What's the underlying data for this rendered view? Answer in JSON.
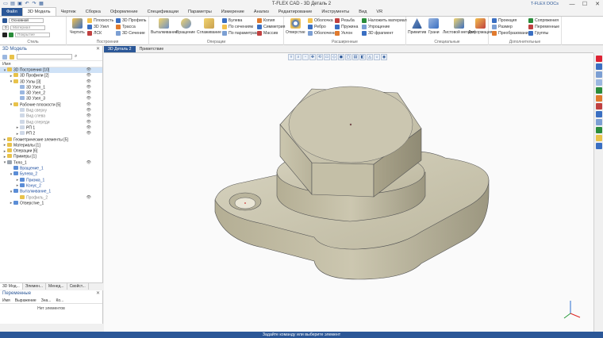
{
  "app": {
    "title": "T-FLEX CAD - 3D Деталь 2",
    "user_label": "T-FLEX DOCs",
    "min": "—",
    "max": "☐",
    "close": "✕"
  },
  "tabs": [
    "Файл",
    "3D Модель",
    "Чертеж",
    "Сборка",
    "Оформление",
    "Спецификации",
    "Параметры",
    "Измерение",
    "Анализ",
    "Редактирование",
    "Инструменты",
    "Вид",
    "VR"
  ],
  "ribbon": {
    "style": {
      "label": "Стиль",
      "style_value": "Основной",
      "material_placeholder": "Материал",
      "coating_placeholder": "Покрытие",
      "thickness_value": "0"
    },
    "construct": {
      "label": "Построения",
      "draw": "Чертить",
      "plane": "Плоскость",
      "node3d": "3D Узел",
      "lsk": "ЛСК",
      "profile3d": "3D Профиль",
      "trace": "Трасса",
      "section3d": "3D Сечение"
    },
    "ops": {
      "label": "Операции",
      "extrude": "Выталкивание",
      "rotate": "Вращение",
      "smooth": "Сглаживание",
      "boolean": "Булева",
      "by_section": "По сечениям",
      "by_params": "По параметрам",
      "copy": "Копия",
      "symmetry": "Симметрия",
      "array": "Массив"
    },
    "ext": {
      "label": "Расширенные",
      "hole": "Отверстие",
      "shell": "Оболочка",
      "rib": "Ребро",
      "offset": "Оболочение",
      "thread": "Резьба",
      "spring": "Пружина",
      "slope": "Уклон",
      "apply_material": "Наложить материал",
      "simplify": "Упрощение",
      "fragment3d": "3D фрагмент"
    },
    "special": {
      "label": "Специальные",
      "primitives": "Примитив",
      "faces": "Грани",
      "sheet_metal": "Листовой металл",
      "deform": "Деформация"
    },
    "extra": {
      "label": "Дополнительные",
      "projection": "Проекция",
      "size": "Размер",
      "transform": "Преобразования",
      "mates": "Сопряжения",
      "variables": "Переменные",
      "groups": "Группы"
    }
  },
  "left_panel": {
    "title": "3D Модель",
    "col_name": "Имя",
    "tree": [
      {
        "label": "3D Построения [10]",
        "indent": 0,
        "toggle": "▾",
        "color": "#e8c24a",
        "cls": "sel",
        "eye": "👁"
      },
      {
        "label": "3D Профили [2]",
        "indent": 1,
        "toggle": "▸",
        "color": "#e8c24a",
        "cls": "",
        "eye": "👁"
      },
      {
        "label": "3D Узлы [3]",
        "indent": 1,
        "toggle": "▾",
        "color": "#e8c24a",
        "cls": "",
        "eye": "👁"
      },
      {
        "label": "3D Узел_1",
        "indent": 2,
        "toggle": "",
        "color": "#9bb7e0",
        "cls": "",
        "eye": "👁"
      },
      {
        "label": "3D Узел_2",
        "indent": 2,
        "toggle": "",
        "color": "#9bb7e0",
        "cls": "",
        "eye": "👁"
      },
      {
        "label": "3D Узел_3",
        "indent": 2,
        "toggle": "",
        "color": "#9bb7e0",
        "cls": "",
        "eye": "👁"
      },
      {
        "label": "Рабочие плоскости [5]",
        "indent": 1,
        "toggle": "▾",
        "color": "#e8c24a",
        "cls": "",
        "eye": "👁"
      },
      {
        "label": "Вид сверху",
        "indent": 2,
        "toggle": "",
        "color": "#cfd8e6",
        "cls": "gray",
        "eye": "👁"
      },
      {
        "label": "Вид слева",
        "indent": 2,
        "toggle": "",
        "color": "#cfd8e6",
        "cls": "gray",
        "eye": "👁"
      },
      {
        "label": "Вид спереди",
        "indent": 2,
        "toggle": "",
        "color": "#cfd8e6",
        "cls": "gray",
        "eye": "👁"
      },
      {
        "label": "РП 1",
        "indent": 2,
        "toggle": "▸",
        "color": "#cfd8e6",
        "cls": "",
        "eye": "👁"
      },
      {
        "label": "РП 2",
        "indent": 2,
        "toggle": "▸",
        "color": "#cfd8e6",
        "cls": "",
        "eye": "👁"
      },
      {
        "label": "Геометрические элементы [5]",
        "indent": 0,
        "toggle": "▸",
        "color": "#e8c24a",
        "cls": "",
        "eye": ""
      },
      {
        "label": "Материалы [1]",
        "indent": 0,
        "toggle": "▸",
        "color": "#e8c24a",
        "cls": "",
        "eye": ""
      },
      {
        "label": "Операции [6]",
        "indent": 0,
        "toggle": "▸",
        "color": "#e8c24a",
        "cls": "",
        "eye": ""
      },
      {
        "label": "Примеры [1]",
        "indent": 0,
        "toggle": "▸",
        "color": "#e8c24a",
        "cls": "",
        "eye": ""
      },
      {
        "label": "Тело_1",
        "indent": 0,
        "toggle": "▾",
        "color": "#9aa3ad",
        "cls": "",
        "eye": "👁"
      },
      {
        "label": "Вращение_1",
        "indent": 1,
        "toggle": "",
        "color": "#5b8dd6",
        "cls": "blue",
        "eye": ""
      },
      {
        "label": "Булева_2",
        "indent": 1,
        "toggle": "▾",
        "color": "#5b8dd6",
        "cls": "blue",
        "eye": ""
      },
      {
        "label": "Призма_1",
        "indent": 2,
        "toggle": "▸",
        "color": "#5b8dd6",
        "cls": "blue",
        "eye": ""
      },
      {
        "label": "Конус_2",
        "indent": 2,
        "toggle": "▸",
        "color": "#5b8dd6",
        "cls": "blue",
        "eye": ""
      },
      {
        "label": "Выталкивание_1",
        "indent": 1,
        "toggle": "▾",
        "color": "#5b8dd6",
        "cls": "blue",
        "eye": ""
      },
      {
        "label": "Профиль_2",
        "indent": 2,
        "toggle": "",
        "color": "#e8c24a",
        "cls": "gray",
        "eye": "👁"
      },
      {
        "label": "Отверстие_1",
        "indent": 1,
        "toggle": "▸",
        "color": "#5b8dd6",
        "cls": "",
        "eye": ""
      }
    ],
    "tabs": [
      "3D Мод...",
      "Элемен...",
      "Менед...",
      "Свойст..."
    ]
  },
  "vars_panel": {
    "title": "Переменные",
    "cols": [
      "Имя",
      "Выражение",
      "Зна...",
      "Ко..."
    ],
    "empty": "Нет элементов"
  },
  "doc_tabs": [
    "3D Деталь 2",
    "Приветствие"
  ],
  "status": "Задайте команду или выберите элемент",
  "colors": {
    "accent": "#2b5797",
    "part": "#c8c3ac"
  }
}
